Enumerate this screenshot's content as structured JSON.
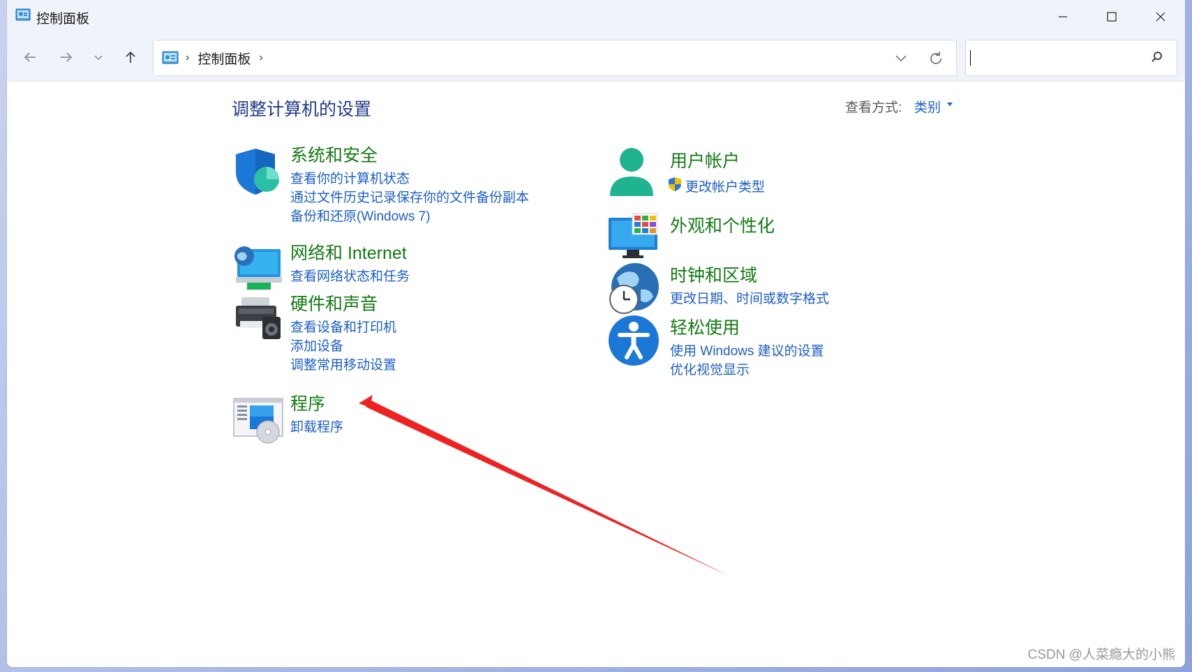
{
  "window": {
    "title": "控制面板"
  },
  "nav": {
    "breadcrumb_sep": "›",
    "breadcrumb": "控制面板",
    "breadcrumb_trailing_sep": "›"
  },
  "search": {
    "placeholder": ""
  },
  "page": {
    "title": "调整计算机的设置",
    "viewby_label": "查看方式:",
    "viewby_value": "类别"
  },
  "categories": {
    "system": {
      "title": "系统和安全",
      "links": [
        "查看你的计算机状态",
        "通过文件历史记录保存你的文件备份副本",
        "备份和还原(Windows 7)"
      ]
    },
    "network": {
      "title": "网络和 Internet",
      "links": [
        "查看网络状态和任务"
      ]
    },
    "hardware": {
      "title": "硬件和声音",
      "links": [
        "查看设备和打印机",
        "添加设备",
        "调整常用移动设置"
      ]
    },
    "programs": {
      "title": "程序",
      "links": [
        "卸载程序"
      ]
    },
    "users": {
      "title": "用户帐户",
      "links": [
        "更改帐户类型"
      ]
    },
    "appearance": {
      "title": "外观和个性化",
      "links": []
    },
    "clock": {
      "title": "时钟和区域",
      "links": [
        "更改日期、时间或数字格式"
      ]
    },
    "ease": {
      "title": "轻松使用",
      "links": [
        "使用 Windows 建议的设置",
        "优化视觉显示"
      ]
    }
  },
  "watermark": "CSDN @人菜瘾大的小熊",
  "colors": {
    "category_title": "#137a13",
    "link": "#1c5fc7",
    "page_title": "#1e3a8a",
    "annotation_arrow": "#ee2222"
  }
}
